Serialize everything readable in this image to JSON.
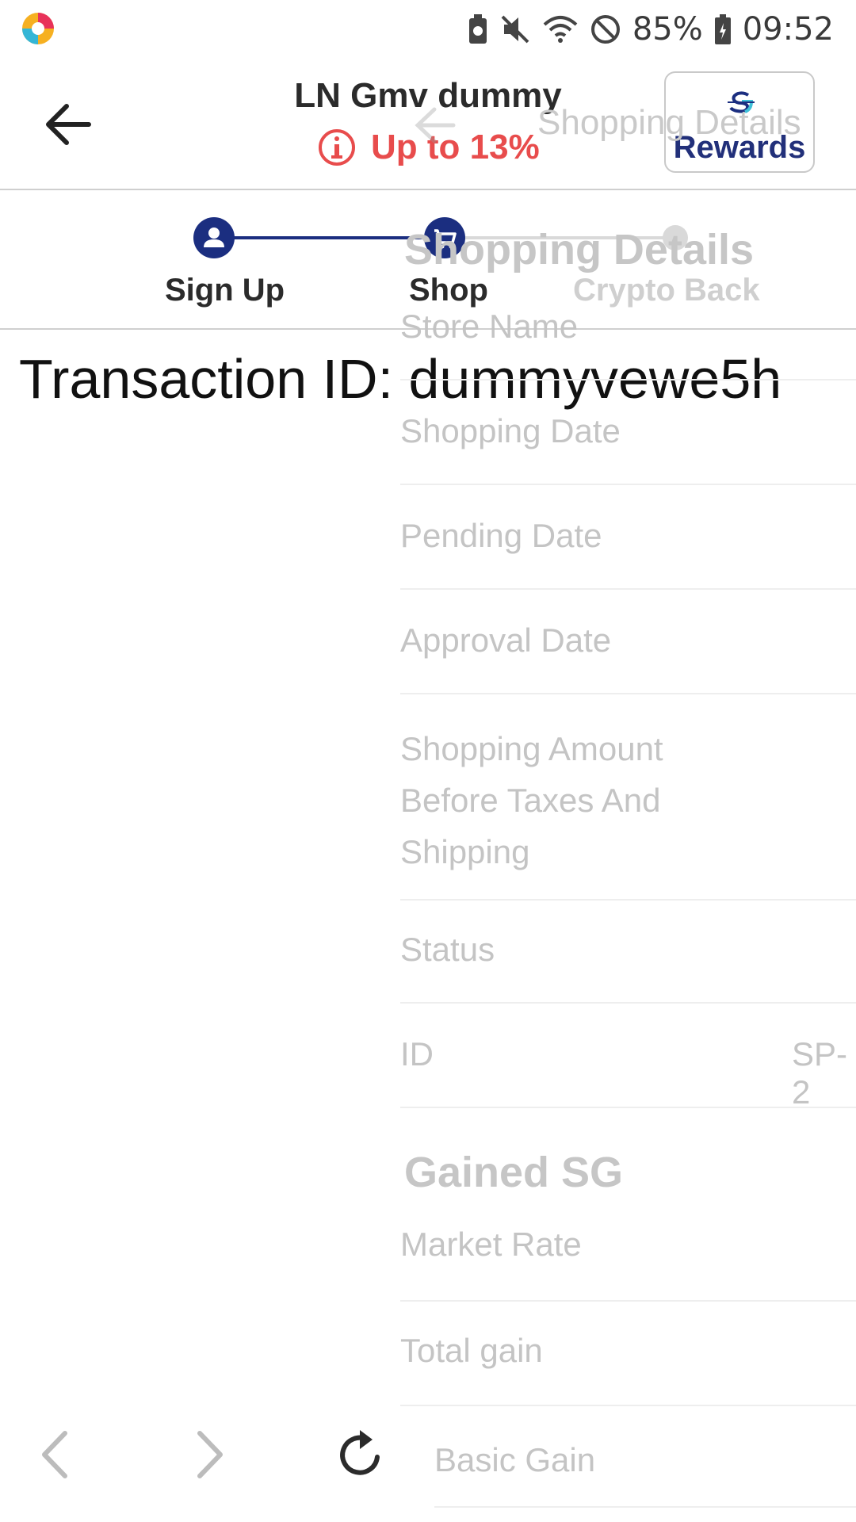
{
  "status_bar": {
    "battery": "85%",
    "time": "09:52"
  },
  "header": {
    "title": "LN Gmv dummy",
    "subtitle": "Up to 13%",
    "rewards_label": "Rewards"
  },
  "stepper": {
    "steps": [
      {
        "label": "Sign Up"
      },
      {
        "label": "Shop"
      },
      {
        "label": "Crypto Back"
      }
    ]
  },
  "transaction": {
    "text": "Transaction ID: dummyvewe5h"
  },
  "ghost_panel": {
    "header_title": "Shopping Details",
    "section_title": "Shopping Details",
    "rows": [
      {
        "label": "Store Name"
      },
      {
        "label": "Shopping Date"
      },
      {
        "label": "Pending Date"
      },
      {
        "label": "Approval Date"
      },
      {
        "label": "Shopping Amount Before Taxes And Shipping"
      },
      {
        "label": "Status"
      },
      {
        "label": "ID",
        "value": "SP-2"
      }
    ],
    "gained_title": "Gained SG",
    "gained_rows": [
      {
        "label": "Market Rate"
      },
      {
        "label": "Total gain"
      },
      {
        "label": "Basic Gain"
      }
    ]
  },
  "colors": {
    "brand_navy": "#1b2e80",
    "alert_red": "#e84c4c"
  }
}
